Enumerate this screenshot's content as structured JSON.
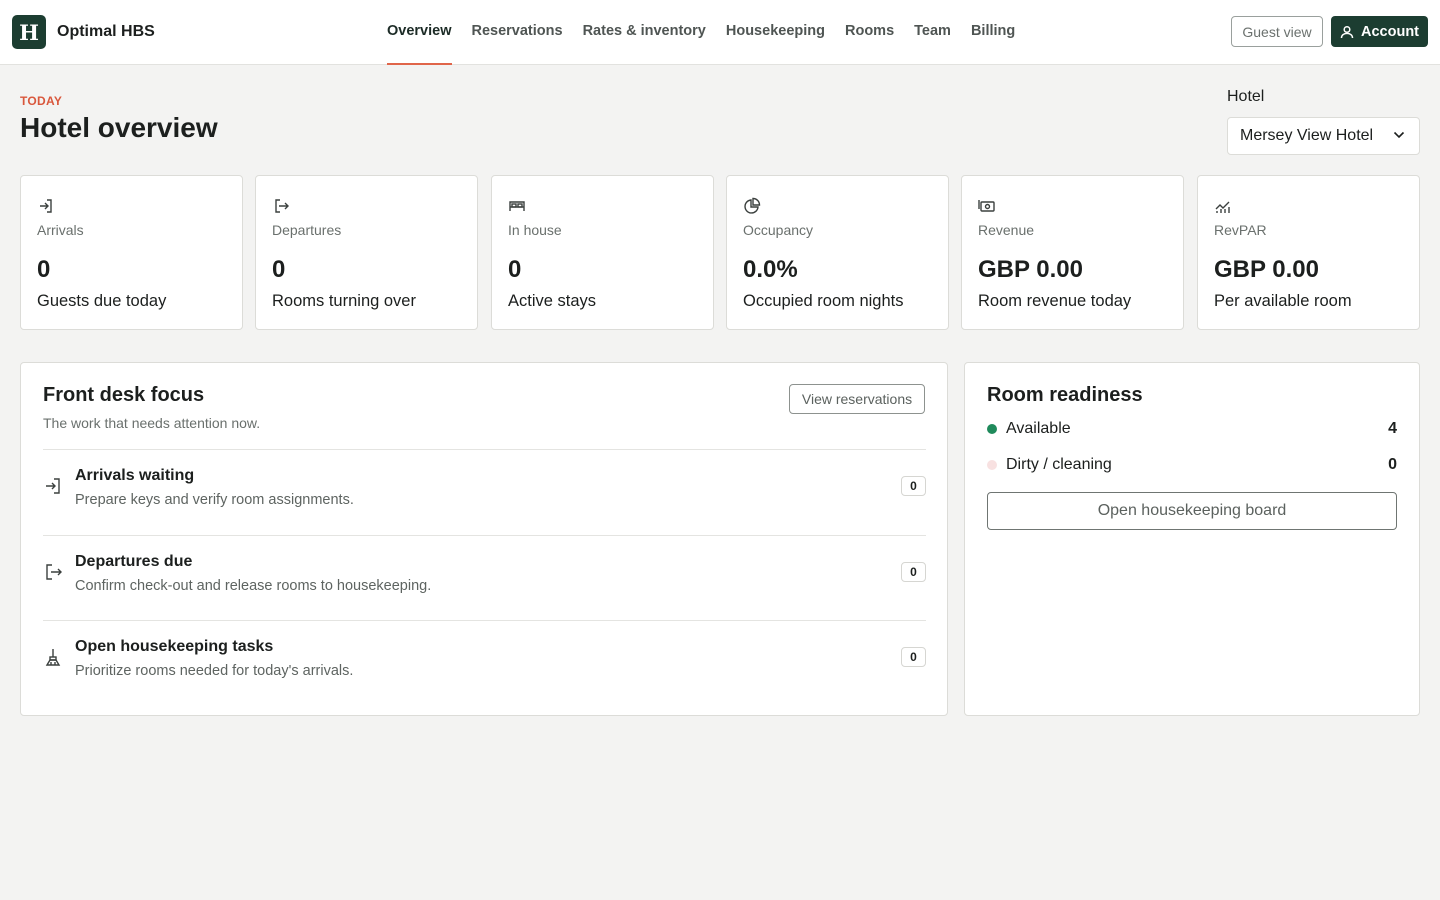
{
  "app": {
    "logo_letter": "H",
    "name": "Optimal HBS"
  },
  "nav": {
    "items": [
      {
        "label": "Overview",
        "active": true
      },
      {
        "label": "Reservations"
      },
      {
        "label": "Rates & inventory"
      },
      {
        "label": "Housekeeping"
      },
      {
        "label": "Rooms"
      },
      {
        "label": "Team"
      },
      {
        "label": "Billing"
      }
    ],
    "guest_view_label": "Guest view",
    "account_label": "Account"
  },
  "page": {
    "eyebrow": "TODAY",
    "title": "Hotel overview",
    "hotel_label": "Hotel",
    "hotel_selected": "Mersey View Hotel"
  },
  "stats": [
    {
      "icon": "arrival-icon",
      "label": "Arrivals",
      "value": "0",
      "sub": "Guests due today"
    },
    {
      "icon": "departure-icon",
      "label": "Departures",
      "value": "0",
      "sub": "Rooms turning over"
    },
    {
      "icon": "bed-icon",
      "label": "In house",
      "value": "0",
      "sub": "Active stays"
    },
    {
      "icon": "pie-chart-icon",
      "label": "Occupancy",
      "value": "0.0%",
      "sub": "Occupied room nights"
    },
    {
      "icon": "banknote-icon",
      "label": "Revenue",
      "value": "GBP 0.00",
      "sub": "Room revenue today"
    },
    {
      "icon": "trend-chart-icon",
      "label": "RevPAR",
      "value": "GBP 0.00",
      "sub": "Per available room"
    }
  ],
  "focus": {
    "title": "Front desk focus",
    "subtitle": "The work that needs attention now.",
    "button_label": "View reservations",
    "tasks": [
      {
        "icon": "arrival-icon",
        "title": "Arrivals waiting",
        "desc": "Prepare keys and verify room assignments.",
        "count": "0"
      },
      {
        "icon": "departure-icon",
        "title": "Departures due",
        "desc": "Confirm check-out and release rooms to housekeeping.",
        "count": "0"
      },
      {
        "icon": "broom-icon",
        "title": "Open housekeeping tasks",
        "desc": "Prioritize rooms needed for today's arrivals.",
        "count": "0"
      }
    ]
  },
  "readiness": {
    "title": "Room readiness",
    "rows": [
      {
        "label": "Available",
        "value": "4",
        "color": "#1f8a5b"
      },
      {
        "label": "Dirty / cleaning",
        "value": "0",
        "color": "#f8e1e1"
      }
    ],
    "button_label": "Open housekeeping board"
  },
  "colors": {
    "brand": "#1c3d31",
    "accent": "#e0654a",
    "background": "#f3f3f2"
  }
}
